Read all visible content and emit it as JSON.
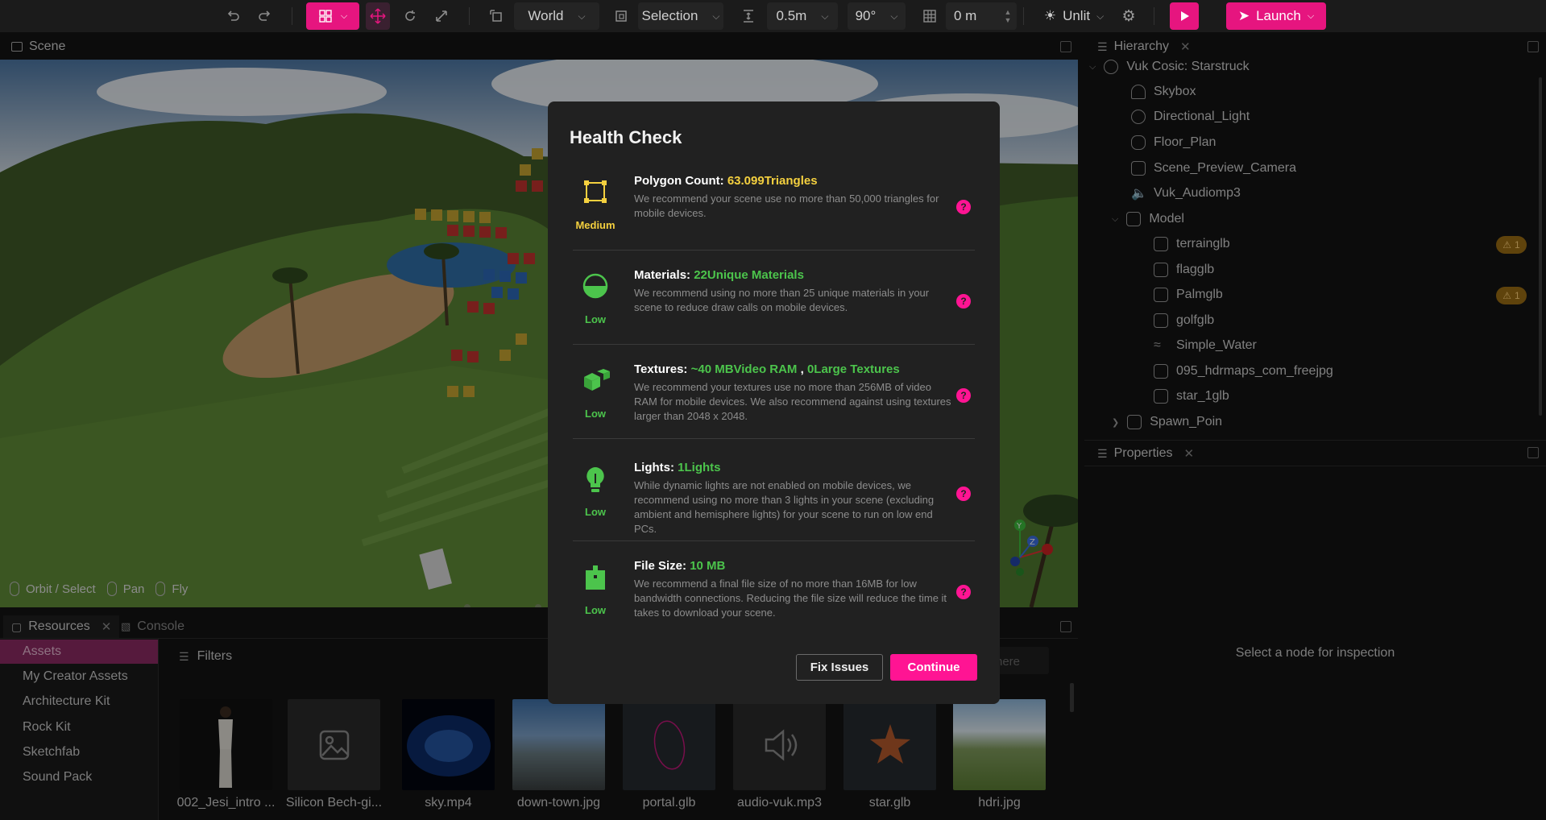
{
  "toolbar": {
    "coord_space": "World",
    "selection_mode": "Selection",
    "snap_distance": "0.5m",
    "snap_angle": "90°",
    "grid_value": "0 m",
    "lighting_mode": "Unlit",
    "launch_label": "Launch"
  },
  "scene": {
    "tab_label": "Scene",
    "hints": [
      "Orbit / Select",
      "Pan",
      "Fly"
    ],
    "gizmo": {
      "y": "Y",
      "z": "Z"
    }
  },
  "hierarchy": {
    "tab_label": "Hierarchy",
    "root": "Vuk Cosic: Starstruck",
    "items": [
      {
        "label": "Skybox",
        "icon": "skybox-icon"
      },
      {
        "label": "Directional_Light",
        "icon": "light-icon"
      },
      {
        "label": "Floor_Plan",
        "icon": "floor-icon"
      },
      {
        "label": "Scene_Preview_Camera",
        "icon": "camera-icon"
      },
      {
        "label": "Vuk_Audiomp3",
        "icon": "speaker-icon"
      },
      {
        "label": "Model",
        "icon": "cube-icon"
      },
      {
        "label": "terrainglb",
        "icon": "cube-icon",
        "warning": "1"
      },
      {
        "label": "flagglb",
        "icon": "cube-icon"
      },
      {
        "label": "Palmglb",
        "icon": "cube-icon",
        "warning": "1"
      },
      {
        "label": "golfglb",
        "icon": "cube-icon"
      },
      {
        "label": "Simple_Water",
        "icon": "water-icon"
      },
      {
        "label": "095_hdrmaps_com_freejpg",
        "icon": "image-icon"
      },
      {
        "label": "star_1glb",
        "icon": "cube-icon"
      },
      {
        "label": "Spawn_Poin",
        "icon": "cube-icon"
      }
    ]
  },
  "properties": {
    "tab_label": "Properties",
    "empty_text": "Select a node for inspection"
  },
  "resources": {
    "tab_label": "Resources",
    "console_label": "Console",
    "filters_label": "Filters",
    "search_placeholder": "here",
    "sidebar": [
      "Assets",
      "My Creator Assets",
      "Architecture Kit",
      "Rock Kit",
      "Sketchfab",
      "Sound Pack"
    ],
    "assets": [
      "002_Jesi_intro ...",
      "Silicon Bech-gi...",
      "sky.mp4",
      "down-town.jpg",
      "portal.glb",
      "audio-vuk.mp3",
      "star.glb",
      "hdri.jpg"
    ]
  },
  "modal": {
    "title": "Health Check",
    "sections": [
      {
        "title": "Polygon Count:",
        "value": "63.099Triangles",
        "value_color": "#f4d03f",
        "level": "Medium",
        "level_color": "#f4d03f",
        "icon": "polygon-icon",
        "desc": "We recommend your scene use no more than 50,000 triangles for mobile devices."
      },
      {
        "title": "Materials:",
        "value": "22Unique Materials",
        "value_color": "#4cc44c",
        "level": "Low",
        "level_color": "#4cc44c",
        "icon": "material-icon",
        "desc": "We recommend using no more than 25 unique materials in your scene to reduce draw calls on mobile devices."
      },
      {
        "title": "Textures:",
        "value": "~40 MBVideo RAM",
        "value_sep": " , ",
        "value2": "0Large Textures",
        "value_color": "#4cc44c",
        "level": "Low",
        "level_color": "#4cc44c",
        "icon": "texture-icon",
        "desc": "We recommend your textures use no more than 256MB of video RAM for mobile devices. We also recommend against using textures larger than 2048 x 2048."
      },
      {
        "title": "Lights:",
        "value": "1Lights",
        "value_color": "#4cc44c",
        "level": "Low",
        "level_color": "#4cc44c",
        "icon": "lightbulb-icon",
        "desc": "While dynamic lights are not enabled on mobile devices, we recommend using no more than 3 lights in your scene (excluding ambient and hemisphere lights) for your scene to run on low end PCs."
      },
      {
        "title": "File Size:",
        "value": "10 MB",
        "value_color": "#4cc44c",
        "level": "Low",
        "level_color": "#4cc44c",
        "icon": "file-icon",
        "desc": "We recommend a final file size of no more than 16MB for low bandwidth connections. Reducing the file size will reduce the time it takes to download your scene."
      }
    ],
    "fix_label": "Fix Issues",
    "continue_label": "Continue"
  },
  "colors": {
    "accent": "#e6157f",
    "modal_bg": "#212121",
    "warning": "#9a6c14"
  }
}
